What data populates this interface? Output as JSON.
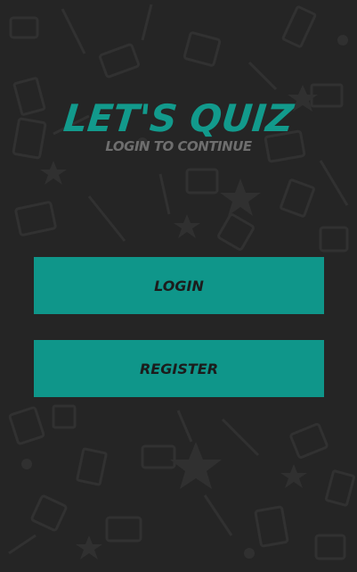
{
  "app": {
    "title": "LET'S QUIZ",
    "subtitle": "LOGIN TO CONTINUE"
  },
  "actions": {
    "login_label": "LOGIN",
    "register_label": "REGISTER"
  },
  "colors": {
    "background": "#252525",
    "accent": "#0f968a",
    "title": "#129a8c",
    "subtitle": "#6e6e6e",
    "pattern": "#303030"
  }
}
